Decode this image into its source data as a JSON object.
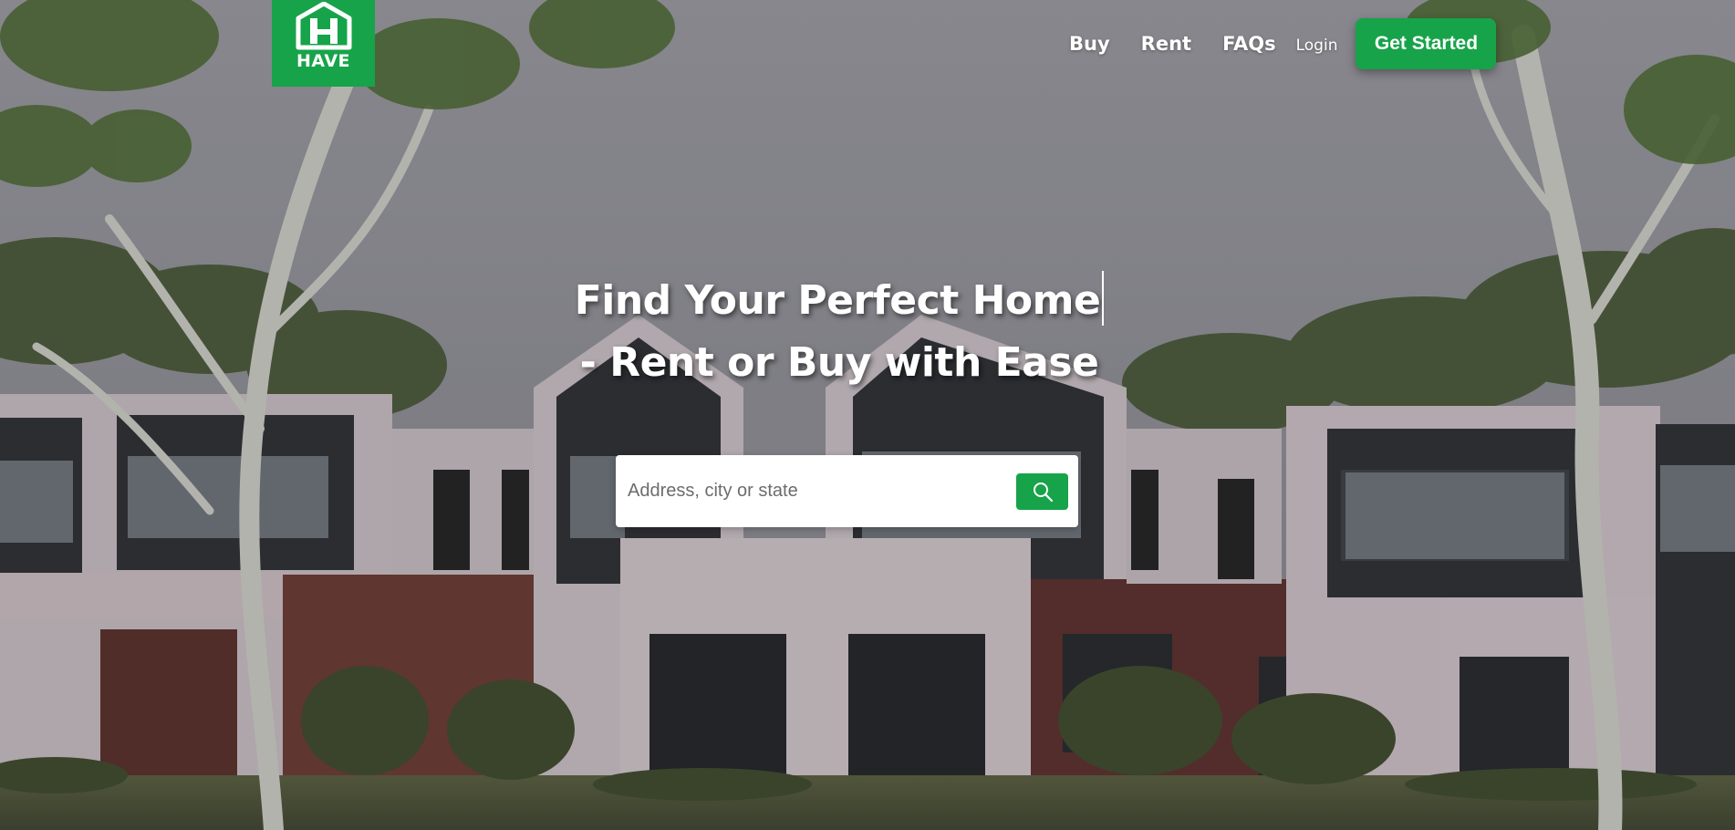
{
  "brand": {
    "name": "HAVE",
    "color": "#17a34a"
  },
  "nav": {
    "links": [
      {
        "label": "Buy"
      },
      {
        "label": "Rent"
      },
      {
        "label": "FAQs"
      }
    ],
    "login_label": "Login",
    "cta_label": "Get Started"
  },
  "hero": {
    "headline_line1": "Find Your Perfect Home",
    "headline_line2": "- Rent or Buy with Ease"
  },
  "search": {
    "placeholder": "Address, city or state",
    "value": "",
    "button_icon": "search-icon"
  },
  "colors": {
    "accent": "#17a34a",
    "text_on_dark": "#ffffff"
  }
}
